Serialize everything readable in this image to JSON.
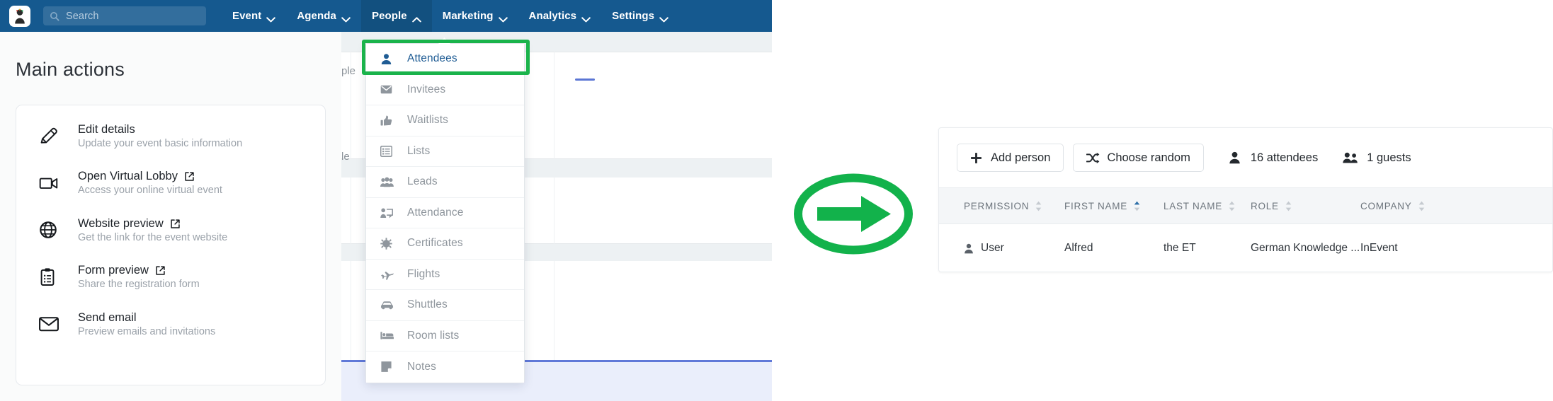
{
  "navbar": {
    "logo_icon": "event-logo-icon",
    "search": {
      "placeholder": "Search",
      "value": "",
      "icon": "search-icon"
    },
    "items": [
      {
        "label": "Event",
        "caret": "chevron-down-icon",
        "active": false
      },
      {
        "label": "Agenda",
        "caret": "chevron-down-icon",
        "active": false
      },
      {
        "label": "People",
        "caret": "chevron-up-icon",
        "active": true
      },
      {
        "label": "Marketing",
        "caret": "chevron-down-icon",
        "active": false
      },
      {
        "label": "Analytics",
        "caret": "chevron-down-icon",
        "active": false
      },
      {
        "label": "Settings",
        "caret": "chevron-down-icon",
        "active": false
      }
    ],
    "background_color": "#15598f",
    "active_item_color": "#12507f"
  },
  "main": {
    "title": "Main actions",
    "actions": [
      {
        "icon": "pencil-icon",
        "title": "Edit details",
        "subtitle": "Update your event basic information",
        "external": false
      },
      {
        "icon": "video-camera-icon",
        "title": "Open Virtual Lobby",
        "subtitle": "Access your online virtual event",
        "external": true
      },
      {
        "icon": "globe-icon",
        "title": "Website preview",
        "subtitle": "Get the link for the event website",
        "external": true
      },
      {
        "icon": "clipboard-icon",
        "title": "Form preview",
        "subtitle": "Share the registration form",
        "external": true
      },
      {
        "icon": "envelope-icon",
        "title": "Send email",
        "subtitle": "Preview emails and invitations",
        "external": false
      }
    ]
  },
  "background_panel": {
    "partial_labels": [
      "ple",
      "le"
    ]
  },
  "dropdown": {
    "highlight_color": "#1ab34b",
    "items": [
      {
        "icon": "person-icon",
        "label": "Attendees",
        "highlighted": true
      },
      {
        "icon": "envelope-icon",
        "label": "Invitees",
        "highlighted": false
      },
      {
        "icon": "thumbs-up-icon",
        "label": "Waitlists",
        "highlighted": false
      },
      {
        "icon": "list-icon",
        "label": "Lists",
        "highlighted": false
      },
      {
        "icon": "people-group-icon",
        "label": "Leads",
        "highlighted": false
      },
      {
        "icon": "attendance-icon",
        "label": "Attendance",
        "highlighted": false
      },
      {
        "icon": "certificate-icon",
        "label": "Certificates",
        "highlighted": false
      },
      {
        "icon": "airplane-icon",
        "label": "Flights",
        "highlighted": false
      },
      {
        "icon": "car-icon",
        "label": "Shuttles",
        "highlighted": false
      },
      {
        "icon": "bed-icon",
        "label": "Room lists",
        "highlighted": false
      },
      {
        "icon": "note-icon",
        "label": "Notes",
        "highlighted": false
      }
    ]
  },
  "annotation": {
    "icon": "arrow-right-circle-icon",
    "color": "#1ab34b"
  },
  "attendees_panel": {
    "toolbar": {
      "add_person_label": "Add person",
      "add_person_icon": "plus-icon",
      "choose_random_label": "Choose random",
      "choose_random_icon": "shuffle-icon",
      "attendees_count_label": "16 attendees",
      "attendees_icon": "person-icon",
      "guests_count_label": "1 guests",
      "guests_icon": "people-group-icon"
    },
    "table": {
      "columns": [
        {
          "label": "PERMISSION",
          "sort": "none"
        },
        {
          "label": "FIRST NAME",
          "sort": "asc"
        },
        {
          "label": "LAST NAME",
          "sort": "none"
        },
        {
          "label": "ROLE",
          "sort": "none"
        },
        {
          "label": "COMPANY",
          "sort": "none"
        }
      ],
      "sort_active_color": "#2e6fa8",
      "rows": [
        {
          "permission": "User",
          "permission_icon": "person-icon",
          "first_name": "Alfred",
          "last_name": "the ET",
          "role": "German Knowledge ...",
          "company": "InEvent"
        }
      ]
    }
  }
}
